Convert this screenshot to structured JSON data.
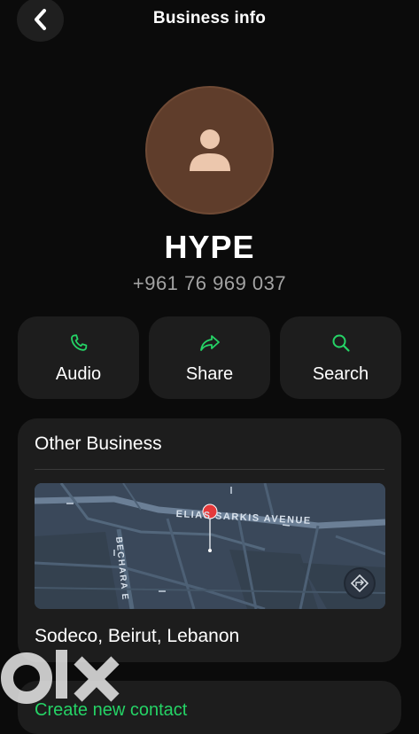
{
  "header": {
    "title": "Business info"
  },
  "profile": {
    "name": "HYPE",
    "phone": "+961 76 969 037"
  },
  "actions": [
    {
      "label": "Audio",
      "icon": "phone-icon"
    },
    {
      "label": "Share",
      "icon": "share-icon"
    },
    {
      "label": "Search",
      "icon": "search-icon"
    }
  ],
  "business_card": {
    "title": "Other Business",
    "map_street_1": "ELIAS SARKIS AVENUE",
    "map_street_2": "BECHARA E",
    "address": "Sodeco, Beirut, Lebanon"
  },
  "create_contact": {
    "label": "Create new contact"
  },
  "watermark": {
    "text": "olx"
  },
  "colors": {
    "accent": "#25d366",
    "avatar": "#5f3d2b",
    "card": "#1d1d1d"
  }
}
